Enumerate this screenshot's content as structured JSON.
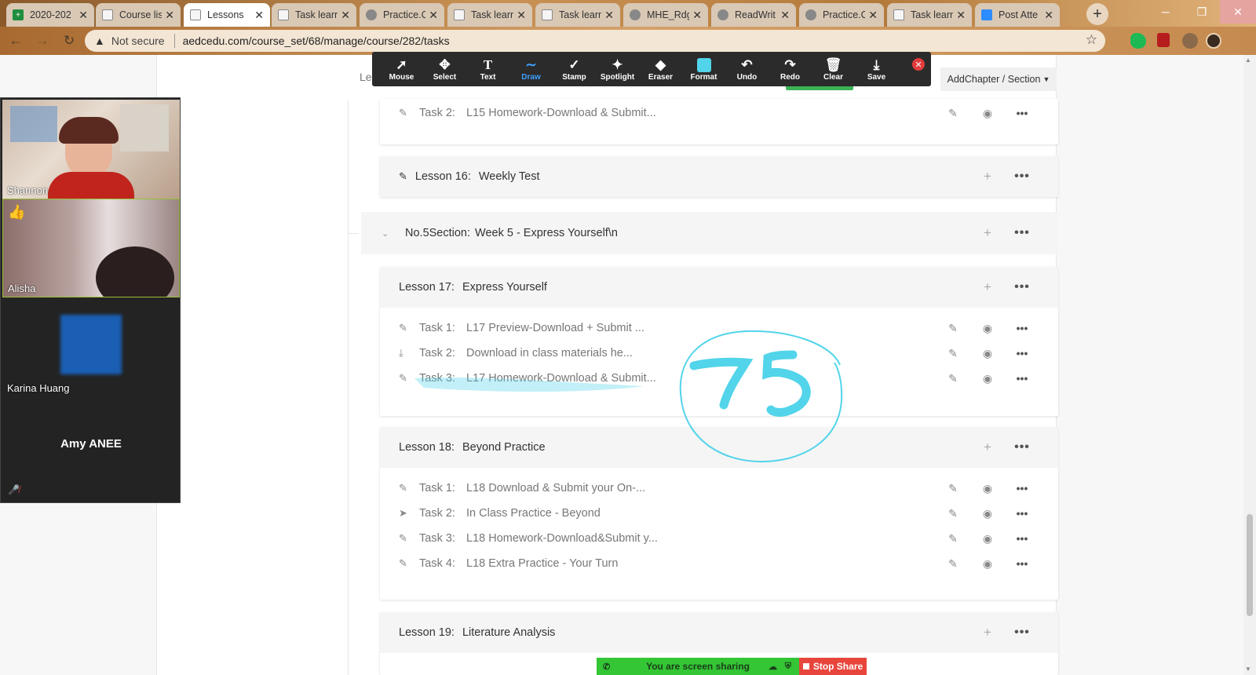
{
  "browser": {
    "tabs": [
      {
        "label": "2020-202",
        "icon": "green-plus-icon",
        "active": false
      },
      {
        "label": "Course lis",
        "icon": "course-icon",
        "active": false
      },
      {
        "label": "Lessons",
        "icon": "course-icon",
        "active": true
      },
      {
        "label": "Task learn",
        "icon": "course-icon",
        "active": false
      },
      {
        "label": "Practice.C",
        "icon": "globe-icon",
        "active": false
      },
      {
        "label": "Task learn",
        "icon": "course-icon",
        "active": false
      },
      {
        "label": "Task learn",
        "icon": "course-icon",
        "active": false
      },
      {
        "label": "MHE_Rdg",
        "icon": "globe-icon",
        "active": false
      },
      {
        "label": "ReadWrit",
        "icon": "globe-icon",
        "active": false
      },
      {
        "label": "Practice.C",
        "icon": "globe-icon",
        "active": false
      },
      {
        "label": "Task learn",
        "icon": "course-icon",
        "active": false
      },
      {
        "label": "Post Atte",
        "icon": "zoom-icon",
        "active": false
      }
    ],
    "not_secure": "Not secure",
    "url": "aedcedu.com/course_set/68/manage/course/282/tasks"
  },
  "annotation_toolbar": {
    "tools": [
      "Mouse",
      "Select",
      "Text",
      "Draw",
      "Stamp",
      "Spotlight",
      "Eraser",
      "Format",
      "Undo",
      "Redo",
      "Clear",
      "Save"
    ],
    "active_tool": "Draw",
    "format_color": "#52d4ea"
  },
  "header": {
    "left_fragment": "Le",
    "add_chapter_label": "AddChapter / Section"
  },
  "course": {
    "top_task": {
      "num": "Task 2:",
      "title": "L15 Homework-Download & Submit..."
    },
    "lesson16": {
      "title": "Lesson 16:",
      "name": "Weekly Test"
    },
    "section5": {
      "title": "No.5Section:",
      "name": "Week 5 - Express Yourself\\n"
    },
    "lesson17": {
      "title": "Lesson 17:",
      "name": "Express Yourself",
      "tasks": [
        {
          "num": "Task 1:",
          "title": "L17 Preview-Download + Submit ...",
          "icon": "pencil-icon"
        },
        {
          "num": "Task 2:",
          "title": "Download in class materials he...",
          "icon": "download-icon"
        },
        {
          "num": "Task 3:",
          "title": "L17 Homework-Download & Submit...",
          "icon": "pencil-icon"
        }
      ]
    },
    "lesson18": {
      "title": "Lesson 18:",
      "name": "Beyond Practice",
      "tasks": [
        {
          "num": "Task 1:",
          "title": "L18 Download & Submit your On-...",
          "icon": "pencil-icon"
        },
        {
          "num": "Task 2:",
          "title": "In Class Practice - Beyond",
          "icon": "send-icon"
        },
        {
          "num": "Task 3:",
          "title": "L18 Homework-Download&Submit y...",
          "icon": "pencil-icon"
        },
        {
          "num": "Task 4:",
          "title": "L18 Extra Practice - Your Turn",
          "icon": "pencil-icon"
        }
      ]
    },
    "lesson19": {
      "title": "Lesson 19:",
      "name": "Literature Analysis"
    }
  },
  "annotation_drawing": {
    "text": "75",
    "color": "#52d4ea"
  },
  "video_panel": {
    "participants": [
      "Shannon",
      "Alisha",
      "Karina Huang",
      "Amy ANEE"
    ]
  },
  "share_bar": {
    "status": "You are screen sharing",
    "stop_label": "Stop Share"
  }
}
